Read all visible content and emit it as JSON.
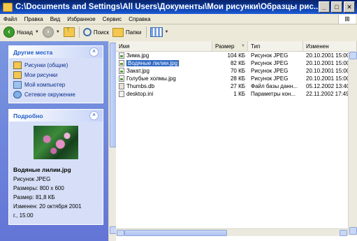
{
  "window": {
    "title": "C:\\Documents and Settings\\All Users\\Документы\\Мои рисунки\\Образцы рис...",
    "buttons": {
      "minimize": "_",
      "maximize": "□",
      "close": "✕"
    }
  },
  "menu": [
    "Файл",
    "Правка",
    "Вид",
    "Избранное",
    "Сервис",
    "Справка"
  ],
  "toolbar": {
    "back_label": "Назад",
    "search_label": "Поиск",
    "folders_label": "Папки"
  },
  "left_pane": {
    "other_places": {
      "title": "Другие места",
      "items": [
        {
          "label": "Рисунки (общие)",
          "icon": "folder-icon"
        },
        {
          "label": "Мои рисунки",
          "icon": "folder-icon"
        },
        {
          "label": "Мой компьютер",
          "icon": "computer-icon"
        },
        {
          "label": "Сетевое окружение",
          "icon": "network-icon"
        }
      ]
    },
    "details": {
      "title": "Подробно",
      "name": "Водяные лилии.jpg",
      "type": "Рисунок JPEG",
      "dimensions": "Размеры: 800 x 600",
      "size": "Размер: 81,8 КБ",
      "modified_1": "Изменен: 20 октября 2001",
      "modified_2": "г., 15:00"
    }
  },
  "columns": [
    "Имя",
    "Размер",
    "Тип",
    "Изменен"
  ],
  "files": [
    {
      "name": "Зима.jpg",
      "size": "104 КБ",
      "type": "Рисунок JPEG",
      "modified": "20.10.2001 15:00",
      "icon": "jpg"
    },
    {
      "name": "Водяные лилии.jpg",
      "size": "82 КБ",
      "type": "Рисунок JPEG",
      "modified": "20.10.2001 15:00",
      "icon": "jpg",
      "selected": true
    },
    {
      "name": "Закат.jpg",
      "size": "70 КБ",
      "type": "Рисунок JPEG",
      "modified": "20.10.2001 15:00",
      "icon": "jpg"
    },
    {
      "name": "Голубые холмы.jpg",
      "size": "28 КБ",
      "type": "Рисунок JPEG",
      "modified": "20.10.2001 15:00",
      "icon": "jpg"
    },
    {
      "name": "Thumbs.db",
      "size": "27 КБ",
      "type": "Файл базы данн...",
      "modified": "05.12.2002 13:40",
      "icon": "db"
    },
    {
      "name": "desktop.ini",
      "size": "1 КБ",
      "type": "Параметры кон...",
      "modified": "22.11.2002 17:49",
      "icon": "ini"
    }
  ]
}
